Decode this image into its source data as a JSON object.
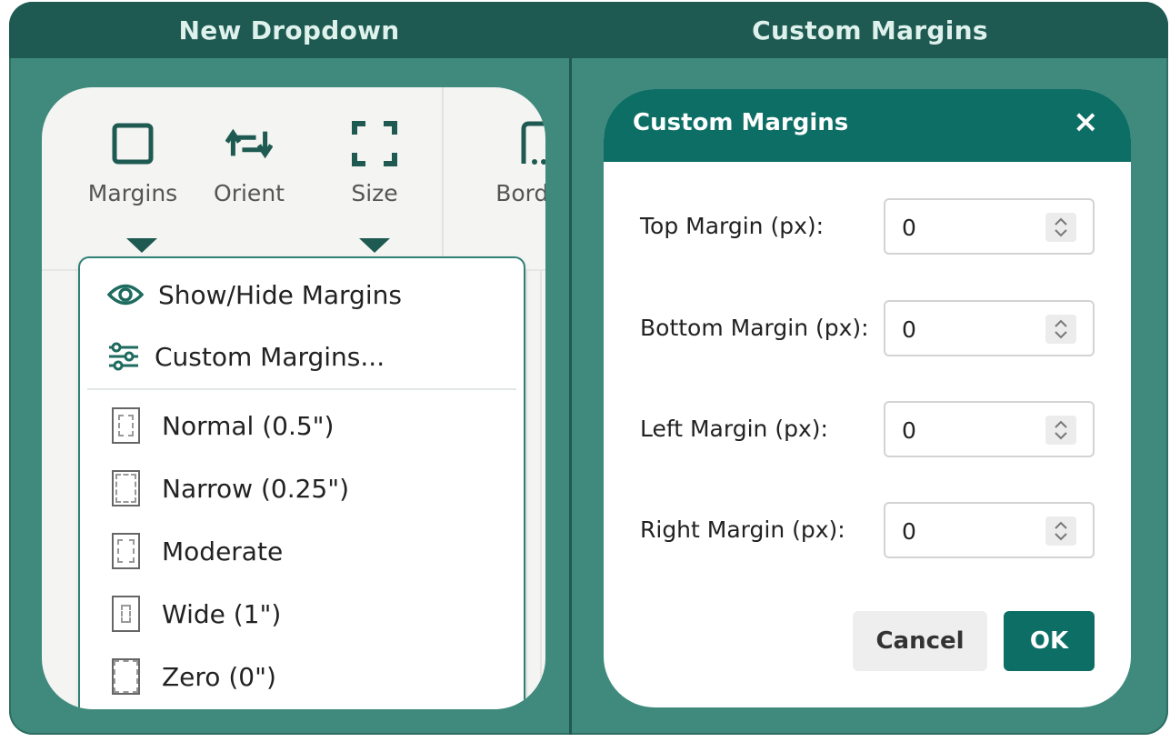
{
  "headers": {
    "left": "New Dropdown",
    "right": "Custom Margins"
  },
  "ribbon": {
    "tools": [
      {
        "label": "Margins",
        "icon": "square-icon"
      },
      {
        "label": "Orient",
        "icon": "rotate-arrows-icon"
      },
      {
        "label": "Size",
        "icon": "corners-frame-icon"
      },
      {
        "label": "Borde",
        "icon": "border-icon"
      }
    ]
  },
  "menu": {
    "items": [
      {
        "label": "Show/Hide Margins",
        "icon": "eye-icon"
      },
      {
        "label": "Custom Margins...",
        "icon": "sliders-icon"
      },
      {
        "label": "Normal (0.5\")",
        "icon": "page-normal-icon"
      },
      {
        "label": "Narrow (0.25\")",
        "icon": "page-narrow-icon"
      },
      {
        "label": "Moderate",
        "icon": "page-moderate-icon"
      },
      {
        "label": "Wide (1\")",
        "icon": "page-wide-icon"
      },
      {
        "label": "Zero (0\")",
        "icon": "page-zero-icon"
      }
    ]
  },
  "dialog": {
    "title": "Custom Margins",
    "close": "×",
    "fields": [
      {
        "label": "Top Margin (px):",
        "value": "0"
      },
      {
        "label": "Bottom Margin (px):",
        "value": "0"
      },
      {
        "label": "Left Margin (px):",
        "value": "0"
      },
      {
        "label": "Right Margin (px):",
        "value": "0"
      }
    ],
    "cancel": "Cancel",
    "ok": "OK"
  },
  "colors": {
    "accent": "#0d6e65",
    "frame": "#3f8a7d",
    "header": "#1e5a51"
  }
}
